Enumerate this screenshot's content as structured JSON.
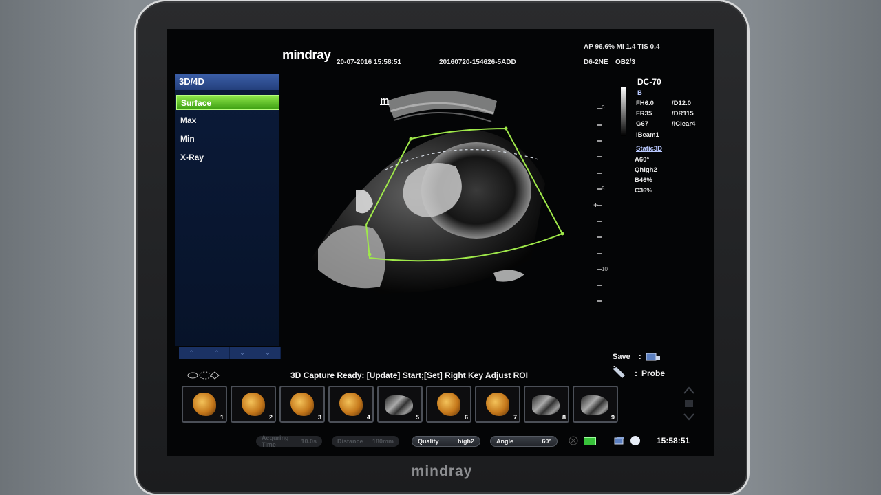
{
  "bezel": {
    "brand": "mindray"
  },
  "header": {
    "brand": "mindray",
    "datetime": "20-07-2016 15:58:51",
    "exam_id": "20160720-154626-5ADD",
    "power": "AP 96.6%  MI 1.4  TIS 0.4",
    "probe": "D6-2NE",
    "preset": "OB2/3"
  },
  "menu": {
    "title": "3D/4D",
    "items": [
      {
        "label": "Surface",
        "active": true
      },
      {
        "label": "Max",
        "active": false
      },
      {
        "label": "Min",
        "active": false
      },
      {
        "label": "X-Ray",
        "active": false
      }
    ],
    "arrows": [
      "⌃",
      "⌃",
      "⌄",
      "⌄"
    ]
  },
  "image": {
    "marker": "m"
  },
  "depth_scale": {
    "labels": [
      "0",
      "5",
      "10"
    ]
  },
  "params": {
    "model": "DC-70",
    "mode": "B",
    "left_col": [
      "FH6.0",
      "FR35",
      "G67",
      "iBeam1"
    ],
    "right_col": [
      "/D12.0",
      "/DR115",
      "/iClear4"
    ],
    "static_label": "Static3D",
    "static_values": [
      "A60°",
      "Qhigh2",
      "B46%",
      "C36%"
    ]
  },
  "controls": {
    "save_label": "Save",
    "save_sep": ":",
    "probe_sep": ":",
    "probe_label": "Probe"
  },
  "status": {
    "message": "3D Capture Ready: [Update] Start;[Set] Right Key Adjust ROI"
  },
  "thumbnails": [
    {
      "number": "1",
      "type": "render"
    },
    {
      "number": "2",
      "type": "render"
    },
    {
      "number": "3",
      "type": "render"
    },
    {
      "number": "4",
      "type": "render"
    },
    {
      "number": "5",
      "type": "bmode"
    },
    {
      "number": "6",
      "type": "render"
    },
    {
      "number": "7",
      "type": "render"
    },
    {
      "number": "8",
      "type": "bmode"
    },
    {
      "number": "9",
      "type": "bmode"
    }
  ],
  "bottom_bar": {
    "acquiring_time": {
      "label": "Acquring Time",
      "value": "10.0s"
    },
    "distance": {
      "label": "Distance",
      "value": "180mm"
    },
    "quality": {
      "label": "Quality",
      "value": "high2"
    },
    "angle": {
      "label": "Angle",
      "value": "60°"
    },
    "clock": "15:58:51"
  },
  "colors": {
    "roi": "#9fe84a",
    "menu_active": "#4caf1c",
    "menu_title": "#2f4f94"
  }
}
